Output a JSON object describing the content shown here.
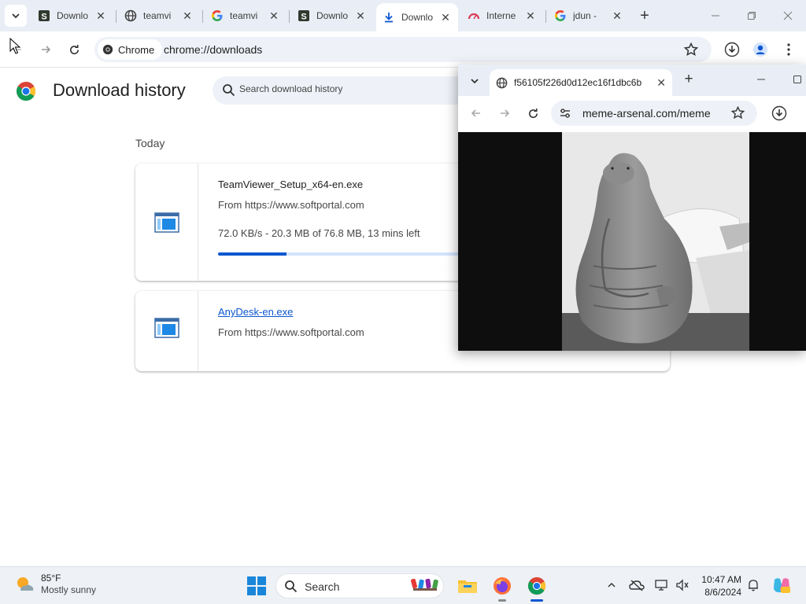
{
  "tabs": [
    {
      "title": "Downlo",
      "favicon": "softportal-icon"
    },
    {
      "title": "teamvi",
      "favicon": "globe-icon"
    },
    {
      "title": "teamvi",
      "favicon": "google-icon"
    },
    {
      "title": "Downlo",
      "favicon": "softportal-icon"
    },
    {
      "title": "Downlo",
      "favicon": "download-icon",
      "active": true
    },
    {
      "title": "Interne",
      "favicon": "speedometer-icon"
    },
    {
      "title": "jdun - ",
      "favicon": "google-icon"
    }
  ],
  "toolbar": {
    "chip_label": "Chrome",
    "url": "chrome://downloads"
  },
  "downloads": {
    "title": "Download history",
    "search_placeholder": "Search download history",
    "section_date": "Today",
    "items": [
      {
        "filename": "TeamViewer_Setup_x64-en.exe",
        "source": "From https://www.softportal.com",
        "status": "72.0 KB/s - 20.3 MB of 76.8 MB, 13 mins left",
        "progress": 0.264,
        "in_progress": true
      },
      {
        "filename": "AnyDesk-en.exe",
        "source": "From https://www.softportal.com",
        "in_progress": false
      }
    ]
  },
  "popup": {
    "tab_title": "f56105f226d0d12ec16f1dbc6b",
    "url": "meme-arsenal.com/meme"
  },
  "taskbar": {
    "temperature": "85°F",
    "condition": "Mostly sunny",
    "search_label": "Search",
    "time": "10:47 AM",
    "date": "8/6/2024"
  },
  "colors": {
    "accent": "#0b57d0",
    "tabstrip": "#e9eef6",
    "omnibox": "#eef2f8"
  }
}
